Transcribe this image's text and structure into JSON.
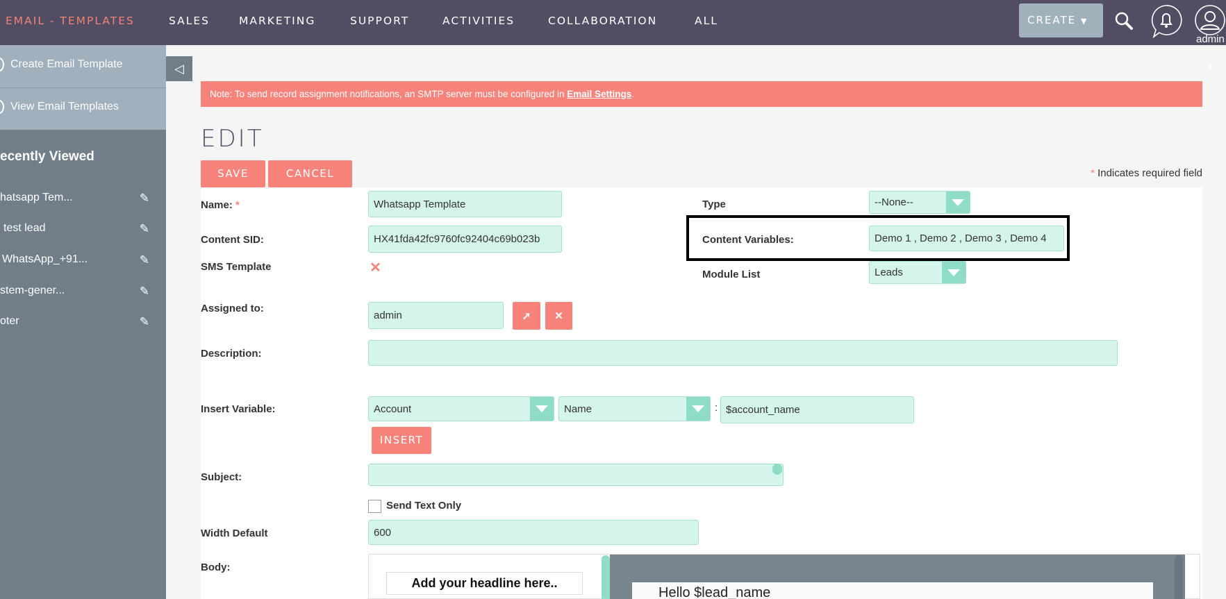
{
  "nav": {
    "module": "EMAIL - TEMPLATES",
    "items": [
      "SALES",
      "MARKETING",
      "SUPPORT",
      "ACTIVITIES",
      "COLLABORATION",
      "ALL"
    ],
    "create": "CREATE",
    "user": "admin"
  },
  "sidebar": {
    "actions": [
      "Create Email Template",
      "View Email Templates"
    ],
    "recent_title": "ecently Viewed",
    "recent": [
      "hatsapp Tem...",
      "test lead",
      "WhatsApp_+91...",
      "stem-gener...",
      "oter"
    ]
  },
  "alert": {
    "text": "Note: To send record assignment notifications, an SMTP server must be configured in ",
    "link": "Email Settings",
    "end": "."
  },
  "page": {
    "title": "EDIT",
    "save": "SAVE",
    "cancel": "CANCEL",
    "required_star": "*",
    "required_note": " Indicates required field"
  },
  "form": {
    "name_label": "Name:",
    "name_star": "*",
    "name_value": "Whatsapp Template",
    "sid_label": "Content SID:",
    "sid_value": "HX41fda42fc9760fc92404c69b023b",
    "sms_label": "SMS Template",
    "sms_checked": true,
    "assigned_label": "Assigned to:",
    "assigned_value": "admin",
    "description_label": "Description:",
    "description_value": "",
    "insert_label": "Insert Variable:",
    "insert_module": "Account",
    "insert_field": "Name",
    "insert_colon": ":",
    "insert_value": "$account_name",
    "insert_btn": "INSERT",
    "subject_label": "Subject:",
    "subject_value": "",
    "send_text_label": "Send Text Only",
    "send_text_checked": false,
    "width_label": "Width Default",
    "width_value": "600",
    "body_label": "Body:",
    "body_headline": "Add your headline here..",
    "body_text": "Hello $lead_name",
    "type_label": "Type",
    "type_value": "--None--",
    "vars_label": "Content Variables:",
    "vars_value": "Demo 1 , Demo 2 , Demo 3 , Demo 4",
    "module_label": "Module List",
    "module_value": "Leads"
  },
  "colors": {
    "topbar": "#534d64",
    "accent": "#f8837a",
    "field": "#d5f4ec",
    "field_arrow": "#8fdcc8",
    "sidebar": "#717e8a"
  }
}
